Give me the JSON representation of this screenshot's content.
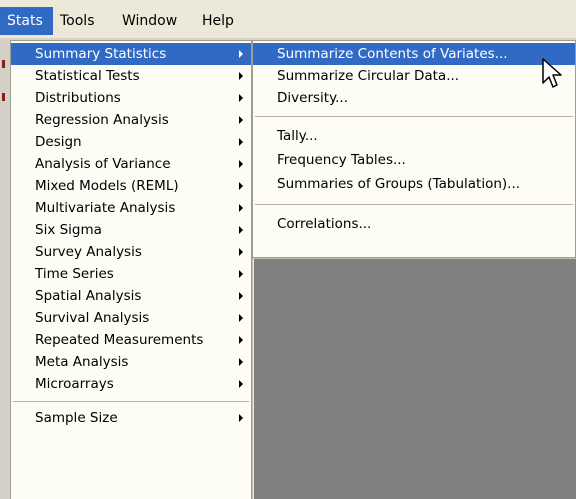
{
  "menubar": {
    "items": [
      "Stats",
      "Tools",
      "Window",
      "Help"
    ],
    "active": "Stats"
  },
  "stats_menu": {
    "items": [
      {
        "label": "Summary Statistics",
        "submenu": true,
        "highlighted": true
      },
      {
        "label": "Statistical Tests",
        "submenu": true
      },
      {
        "label": "Distributions",
        "submenu": true
      },
      {
        "label": "Regression Analysis",
        "submenu": true
      },
      {
        "label": "Design",
        "submenu": true
      },
      {
        "label": "Analysis of Variance",
        "submenu": true
      },
      {
        "label": "Mixed Models (REML)",
        "submenu": true
      },
      {
        "label": "Multivariate Analysis",
        "submenu": true
      },
      {
        "label": "Six Sigma",
        "submenu": true
      },
      {
        "label": "Survey Analysis",
        "submenu": true
      },
      {
        "label": "Time Series",
        "submenu": true
      },
      {
        "label": "Spatial Analysis",
        "submenu": true
      },
      {
        "label": "Survival Analysis",
        "submenu": true
      },
      {
        "label": "Repeated Measurements",
        "submenu": true
      },
      {
        "label": "Meta Analysis",
        "submenu": true
      },
      {
        "label": "Microarrays",
        "submenu": true
      },
      {
        "label": "Sample Size",
        "submenu": true
      }
    ]
  },
  "summary_submenu": {
    "items": [
      {
        "label": "Summarize Contents of Variates...",
        "highlighted": true
      },
      {
        "label": "Summarize Circular Data..."
      },
      {
        "label": "Diversity..."
      },
      {
        "label": "Tally..."
      },
      {
        "label": "Frequency Tables..."
      },
      {
        "label": "Summaries of Groups (Tabulation)..."
      },
      {
        "label": "Correlations..."
      }
    ]
  },
  "colors": {
    "highlight": "#316ac5",
    "menu_bg": "#fdfdf6",
    "workspace": "#808080"
  }
}
